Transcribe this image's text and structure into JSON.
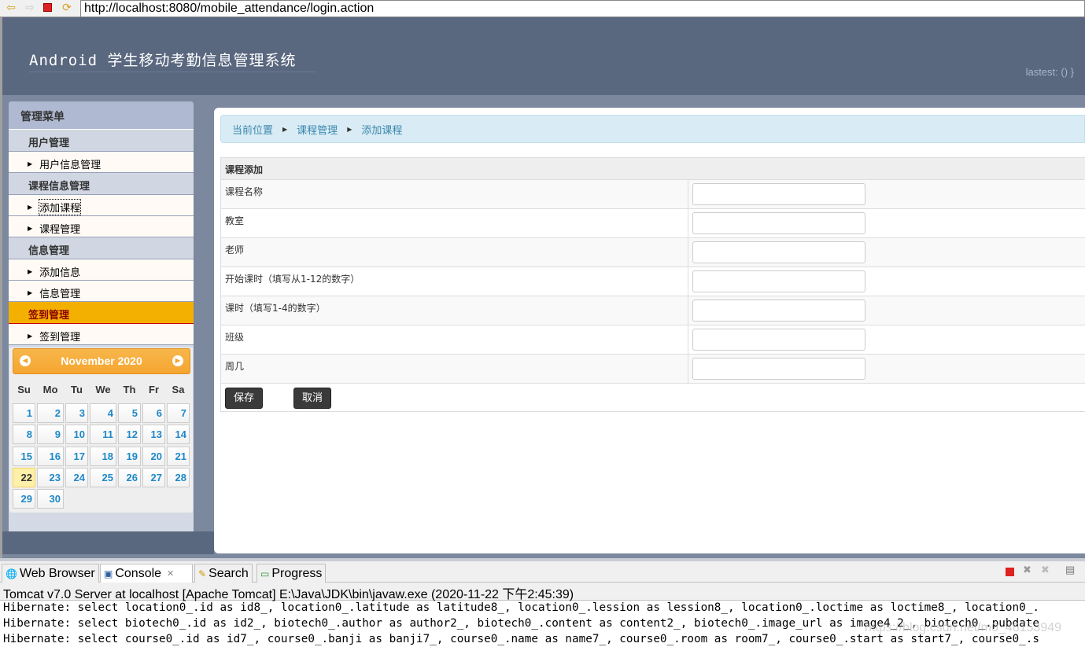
{
  "browser": {
    "url": "http://localhost:8080/mobile_attendance/login.action",
    "icons": [
      "back-icon",
      "forward-icon",
      "stop-icon",
      "refresh-icon"
    ]
  },
  "header": {
    "title": "Android 学生移动考勤信息管理系统",
    "lastest": "lastest:  () }"
  },
  "sidebar": {
    "title": "管理菜单",
    "groups": [
      {
        "label": "用户管理",
        "items": [
          "用户信息管理"
        ]
      },
      {
        "label": "课程信息管理",
        "items": [
          "添加课程",
          "课程管理"
        ]
      },
      {
        "label": "信息管理",
        "items": [
          "添加信息",
          "信息管理"
        ]
      },
      {
        "label": "签到管理",
        "items": [
          "签到管理"
        ]
      }
    ]
  },
  "calendar": {
    "month": "November 2020",
    "weekdays": [
      "Su",
      "Mo",
      "Tu",
      "We",
      "Th",
      "Fr",
      "Sa"
    ],
    "today": "22",
    "days": [
      "1",
      "2",
      "3",
      "4",
      "5",
      "6",
      "7",
      "8",
      "9",
      "10",
      "11",
      "12",
      "13",
      "14",
      "15",
      "16",
      "17",
      "18",
      "19",
      "20",
      "21",
      "22",
      "23",
      "24",
      "25",
      "26",
      "27",
      "28",
      "29",
      "30"
    ]
  },
  "breadcrumb": [
    "当前位置",
    "课程管理",
    "添加课程"
  ],
  "form": {
    "title": "课程添加",
    "fields": [
      "课程名称",
      "教室",
      "老师",
      "开始课时（填写从1-12的数字）",
      "课时（填写1-4的数字）",
      "班级",
      "周几"
    ],
    "save": "保存",
    "cancel": "取消"
  },
  "eclipse": {
    "tabs": [
      "Web Browser",
      "Console",
      "Search",
      "Progress"
    ],
    "console_header": "Tomcat v7.0 Server at localhost [Apache Tomcat] E:\\Java\\JDK\\bin\\javaw.exe (2020-11-22 下午2:45:39)",
    "lines": [
      "Hibernate: select location0_.id as id8_, location0_.latitude as latitude8_, location0_.lession as lession8_, location0_.loctime as loctime8_, location0_.",
      "Hibernate: select biotech0_.id as id2_, biotech0_.author as author2_, biotech0_.content as content2_, biotech0_.image_url as image4_2_, biotech0_.pubdate",
      "Hibernate: select course0_.id as id7_, course0_.banji as banji7_, course0_.name as name7_, course0_.room as room7_, course0_.start as start7_, course0_.s"
    ],
    "watermark": "https://blog.csdn.net/m0_46153949"
  }
}
